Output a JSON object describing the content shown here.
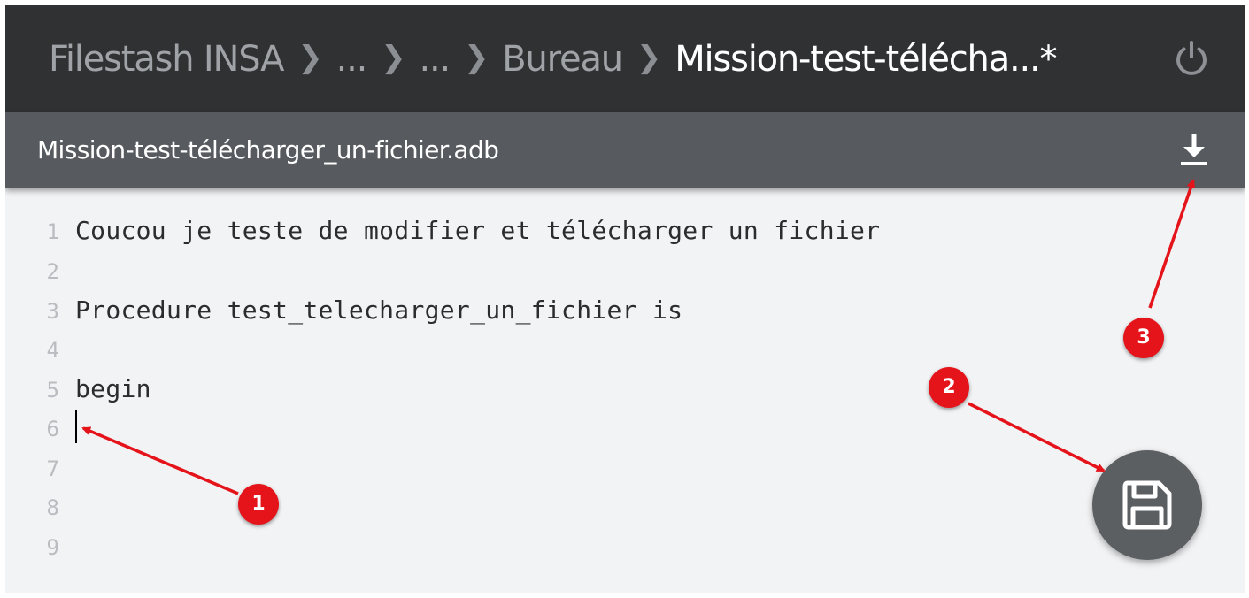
{
  "breadcrumb": {
    "items": [
      "Filestash INSA",
      "...",
      "...",
      "Bureau"
    ],
    "current": "Mission-test-télécha...*",
    "separator": ">"
  },
  "icons": {
    "power": "power-icon",
    "download": "download-icon",
    "save": "floppy-disk-icon"
  },
  "file": {
    "name": "Mission-test-télécharger_un-fichier.adb"
  },
  "editor": {
    "lines": [
      {
        "number": "1",
        "text": "Coucou je teste de modifier et télécharger un fichier"
      },
      {
        "number": "2",
        "text": ""
      },
      {
        "number": "3",
        "text": "Procedure test_telecharger_un_fichier is"
      },
      {
        "number": "4",
        "text": ""
      },
      {
        "number": "5",
        "text": "begin"
      },
      {
        "number": "6",
        "text": ""
      },
      {
        "number": "7",
        "text": ""
      },
      {
        "number": "8",
        "text": ""
      },
      {
        "number": "9",
        "text": ""
      }
    ],
    "cursor_line": 6
  },
  "annotations": {
    "badges": [
      "1",
      "2",
      "3"
    ],
    "color": "#e5141a"
  },
  "colors": {
    "topbar": "#2f3133",
    "filebar": "#575b5f",
    "editor_bg": "#f2f3f5",
    "fab": "#5c5f62"
  }
}
